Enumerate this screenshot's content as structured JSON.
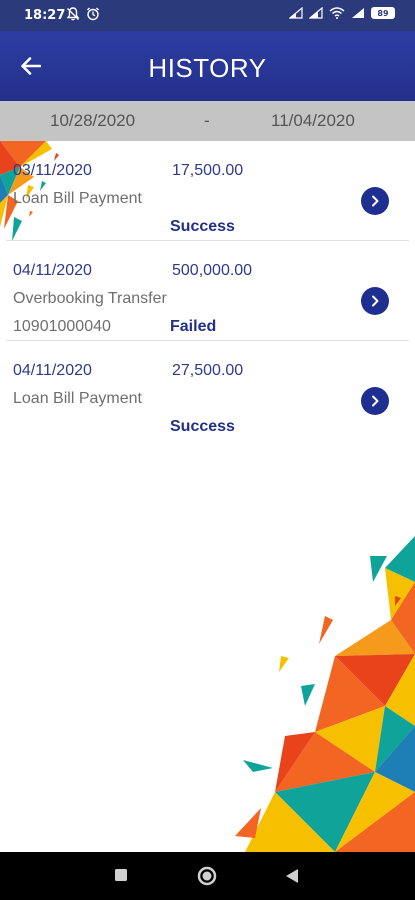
{
  "status_bar": {
    "time": "18:27",
    "battery": "89"
  },
  "header": {
    "title": "HISTORY",
    "back_icon": "arrow-left-icon",
    "background": "#2a3899"
  },
  "date_range": {
    "from": "10/28/2020",
    "separator": "-",
    "to": "11/04/2020"
  },
  "transactions": [
    {
      "date": "03/11/2020",
      "amount": "17,500.00",
      "type": "Loan Bill Payment",
      "account": "",
      "status": "Success"
    },
    {
      "date": "04/11/2020",
      "amount": "500,000.00",
      "type": "Overbooking Transfer",
      "account": "10901000040",
      "status": "Failed"
    },
    {
      "date": "04/11/2020",
      "amount": "27,500.00",
      "type": "Loan Bill Payment",
      "account": "",
      "status": "Success"
    }
  ],
  "colors": {
    "primary": "#23308a",
    "accent_orange": "#f26522",
    "accent_yellow": "#f6c000",
    "accent_teal": "#0fa39a"
  },
  "nav_bar": {
    "icons": [
      "recent-apps-icon",
      "home-icon",
      "back-icon"
    ]
  }
}
